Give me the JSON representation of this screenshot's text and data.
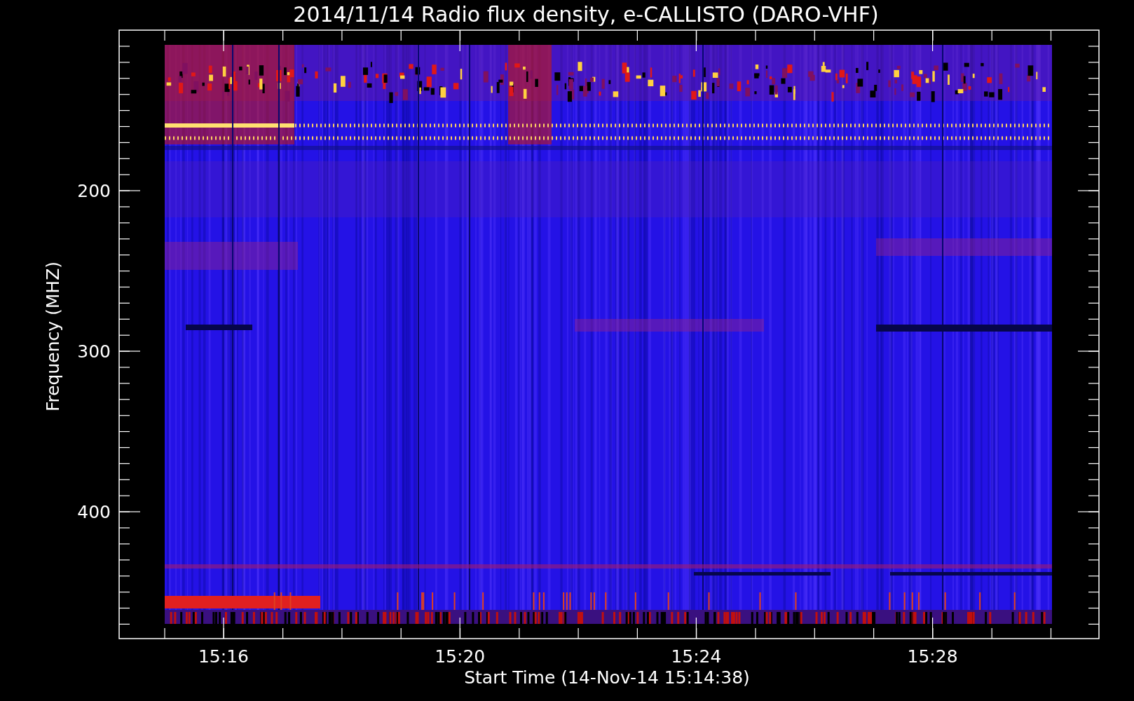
{
  "title": "2014/11/14  Radio flux density, e-CALLISTO (DARO-VHF)",
  "y_axis": {
    "label": "Frequency (MHZ)",
    "ticks": [
      "200",
      "300",
      "400"
    ]
  },
  "x_axis": {
    "label": "Start Time (14-Nov-14 15:14:38)",
    "ticks": [
      "15:16",
      "15:20",
      "15:24",
      "15:28"
    ]
  }
}
